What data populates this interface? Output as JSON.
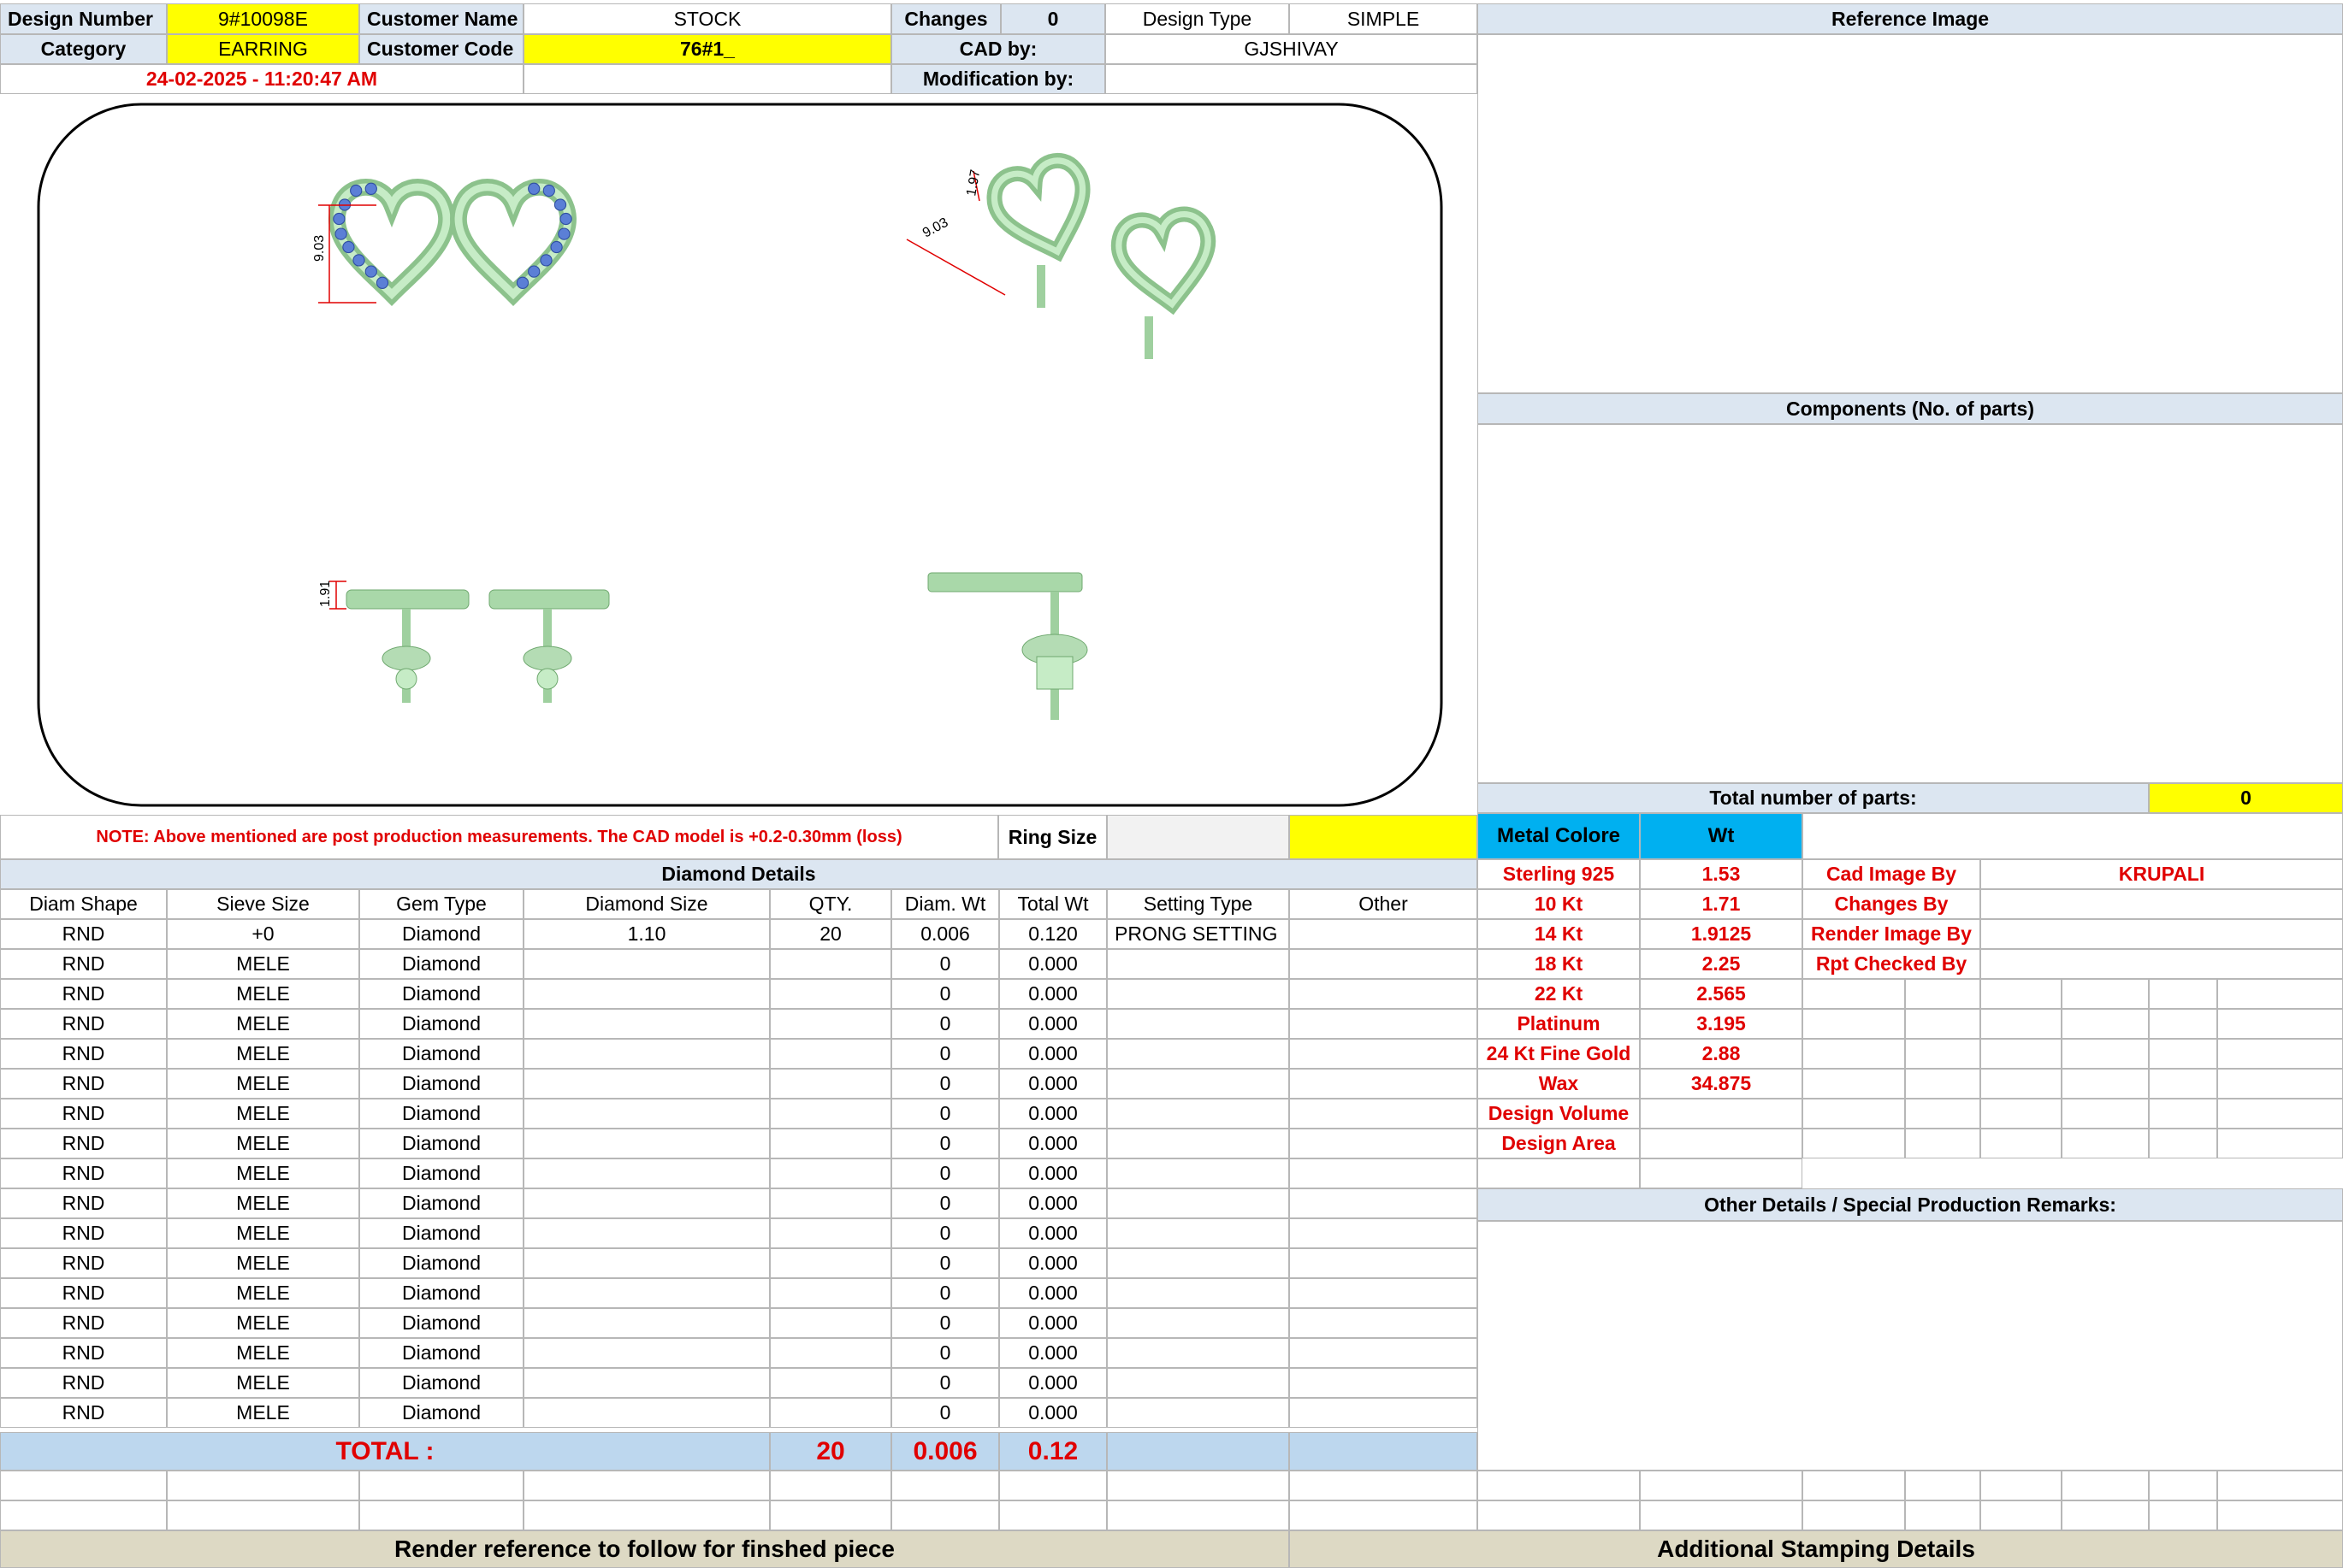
{
  "header": {
    "design_number_label": "Design Number",
    "design_number": "9#10098E",
    "customer_name_label": "Customer Name",
    "customer_name": "STOCK",
    "changes_label": "Changes",
    "changes": "0",
    "design_type_label": "Design Type",
    "design_type": "SIMPLE",
    "category_label": "Category",
    "category": "EARRING",
    "customer_code_label": "Customer Code",
    "customer_code": "76#1_",
    "cad_by_label": "CAD by:",
    "cad_by": "GJSHIVAY",
    "timestamp": "24-02-2025 - 11:20:47 AM",
    "modification_by_label": "Modification by:"
  },
  "reference_image_label": "Reference Image",
  "components_label": "Components (No. of parts)",
  "total_parts_label": "Total number of parts:",
  "total_parts": "0",
  "drawing": {
    "dim_width": "9.03",
    "dim_height": "9.03",
    "dim_thickness": "1.91",
    "dim_iso_a": "1.97",
    "dim_iso_b": "9.03"
  },
  "note": "NOTE: Above mentioned are post production measurements. The CAD model is +0.2-0.30mm (loss)",
  "ring_size_label": "Ring Size",
  "diamond": {
    "title": "Diamond Details",
    "columns": [
      "Diam Shape",
      "Sieve Size",
      "Gem Type",
      "Diamond Size",
      "QTY.",
      "Diam. Wt",
      "Total Wt",
      "Setting Type",
      "Other"
    ],
    "rows": [
      [
        "RND",
        "+0",
        "Diamond",
        "1.10",
        "20",
        "0.006",
        "0.120",
        "PRONG SETTING",
        ""
      ],
      [
        "RND",
        "MELE",
        "Diamond",
        "",
        "",
        "0",
        "0.000",
        "",
        ""
      ],
      [
        "RND",
        "MELE",
        "Diamond",
        "",
        "",
        "0",
        "0.000",
        "",
        ""
      ],
      [
        "RND",
        "MELE",
        "Diamond",
        "",
        "",
        "0",
        "0.000",
        "",
        ""
      ],
      [
        "RND",
        "MELE",
        "Diamond",
        "",
        "",
        "0",
        "0.000",
        "",
        ""
      ],
      [
        "RND",
        "MELE",
        "Diamond",
        "",
        "",
        "0",
        "0.000",
        "",
        ""
      ],
      [
        "RND",
        "MELE",
        "Diamond",
        "",
        "",
        "0",
        "0.000",
        "",
        ""
      ],
      [
        "RND",
        "MELE",
        "Diamond",
        "",
        "",
        "0",
        "0.000",
        "",
        ""
      ],
      [
        "RND",
        "MELE",
        "Diamond",
        "",
        "",
        "0",
        "0.000",
        "",
        ""
      ],
      [
        "RND",
        "MELE",
        "Diamond",
        "",
        "",
        "0",
        "0.000",
        "",
        ""
      ],
      [
        "RND",
        "MELE",
        "Diamond",
        "",
        "",
        "0",
        "0.000",
        "",
        ""
      ],
      [
        "RND",
        "MELE",
        "Diamond",
        "",
        "",
        "0",
        "0.000",
        "",
        ""
      ],
      [
        "RND",
        "MELE",
        "Diamond",
        "",
        "",
        "0",
        "0.000",
        "",
        ""
      ],
      [
        "RND",
        "MELE",
        "Diamond",
        "",
        "",
        "0",
        "0.000",
        "",
        ""
      ],
      [
        "RND",
        "MELE",
        "Diamond",
        "",
        "",
        "0",
        "0.000",
        "",
        ""
      ],
      [
        "RND",
        "MELE",
        "Diamond",
        "",
        "",
        "0",
        "0.000",
        "",
        ""
      ],
      [
        "RND",
        "MELE",
        "Diamond",
        "",
        "",
        "0",
        "0.000",
        "",
        ""
      ]
    ],
    "total_label": "TOTAL :",
    "total_qty": "20",
    "total_diam_wt": "0.006",
    "total_wt": "0.12"
  },
  "metal": {
    "color_label": "Metal Colore",
    "wt_label": "Wt",
    "rows": [
      [
        "Sterling 925",
        "1.53"
      ],
      [
        "10 Kt",
        "1.71"
      ],
      [
        "14 Kt",
        "1.9125"
      ],
      [
        "18 Kt",
        "2.25"
      ],
      [
        "22 Kt",
        "2.565"
      ],
      [
        "Platinum",
        "3.195"
      ],
      [
        "24 Kt Fine Gold",
        "2.88"
      ],
      [
        "Wax",
        "34.875"
      ],
      [
        "Design Volume",
        ""
      ],
      [
        "Design Area",
        ""
      ]
    ]
  },
  "credits": [
    [
      "Cad Image By",
      "KRUPALI"
    ],
    [
      "Changes By",
      ""
    ],
    [
      "Render Image By",
      ""
    ],
    [
      "Rpt Checked By",
      ""
    ]
  ],
  "other_details_label": "Other Details / Special Production Remarks:",
  "footer": {
    "render_ref": "Render reference to follow for finshed piece",
    "stamping": "Additional Stamping Details"
  },
  "colors": {
    "header_blue": "#dce6f1",
    "yellow": "#ffff00",
    "cyan": "#00b0f0",
    "total_blue": "#bdd7ee",
    "footer_tan": "#ddd9c4",
    "red_text": "#e00000",
    "metal_green": "#b4dcb4",
    "stone_blue": "#5b7fd6"
  }
}
